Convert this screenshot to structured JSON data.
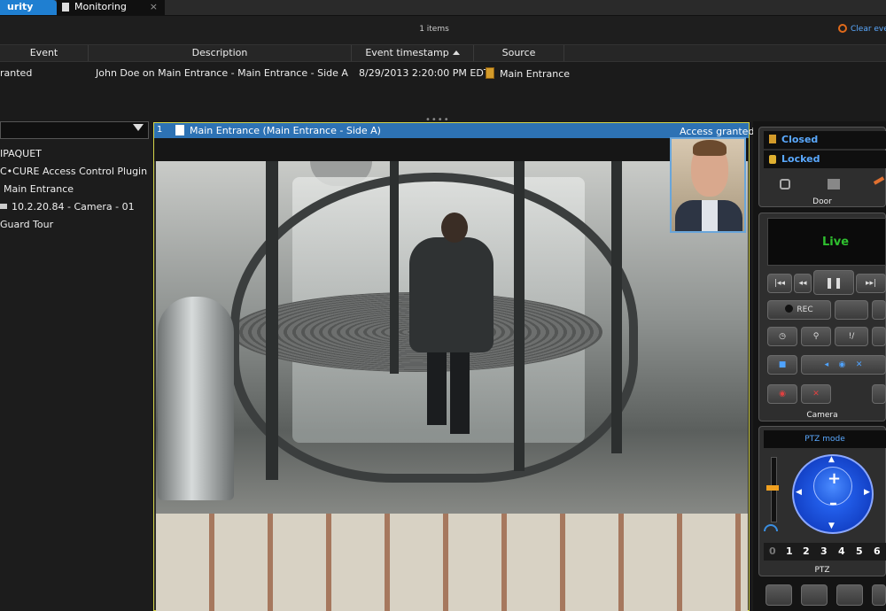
{
  "tabs": {
    "security_desk": "urity Desk",
    "monitoring": "Monitoring",
    "close": "×"
  },
  "events": {
    "count_label": "1 items",
    "clear_label": "Clear eve",
    "columns": [
      "Event",
      "Description",
      "Event timestamp",
      "Source"
    ],
    "rows": [
      {
        "event": "ranted",
        "description": "John Doe on Main Entrance - Main Entrance - Side A",
        "timestamp": "8/29/2013 2:20:00 PM EDT",
        "source": "Main Entrance"
      }
    ],
    "splitter": "••••"
  },
  "tree": {
    "items": [
      "IPAQUET",
      "C•CURE Access Control Plugin",
      "Main Entrance",
      "10.2.20.84 - Camera - 01",
      "Guard Tour"
    ]
  },
  "tile": {
    "number": "1",
    "title": "Main Entrance (Main Entrance - Side A)",
    "status": "Access granted"
  },
  "door_panel": {
    "states": [
      "Closed",
      "Locked"
    ],
    "label": "Door"
  },
  "camera_panel": {
    "live": "Live",
    "rec": "REC",
    "label": "Camera"
  },
  "ptz_panel": {
    "mode": "PTZ mode",
    "presets": [
      "0",
      "1",
      "2",
      "3",
      "4",
      "5",
      "6"
    ],
    "label": "PTZ"
  },
  "colors": {
    "accent": "#2d72b4",
    "tab_active": "#1f7fd1",
    "live_green": "#2fc02f",
    "selection_border": "#d4d44a"
  }
}
